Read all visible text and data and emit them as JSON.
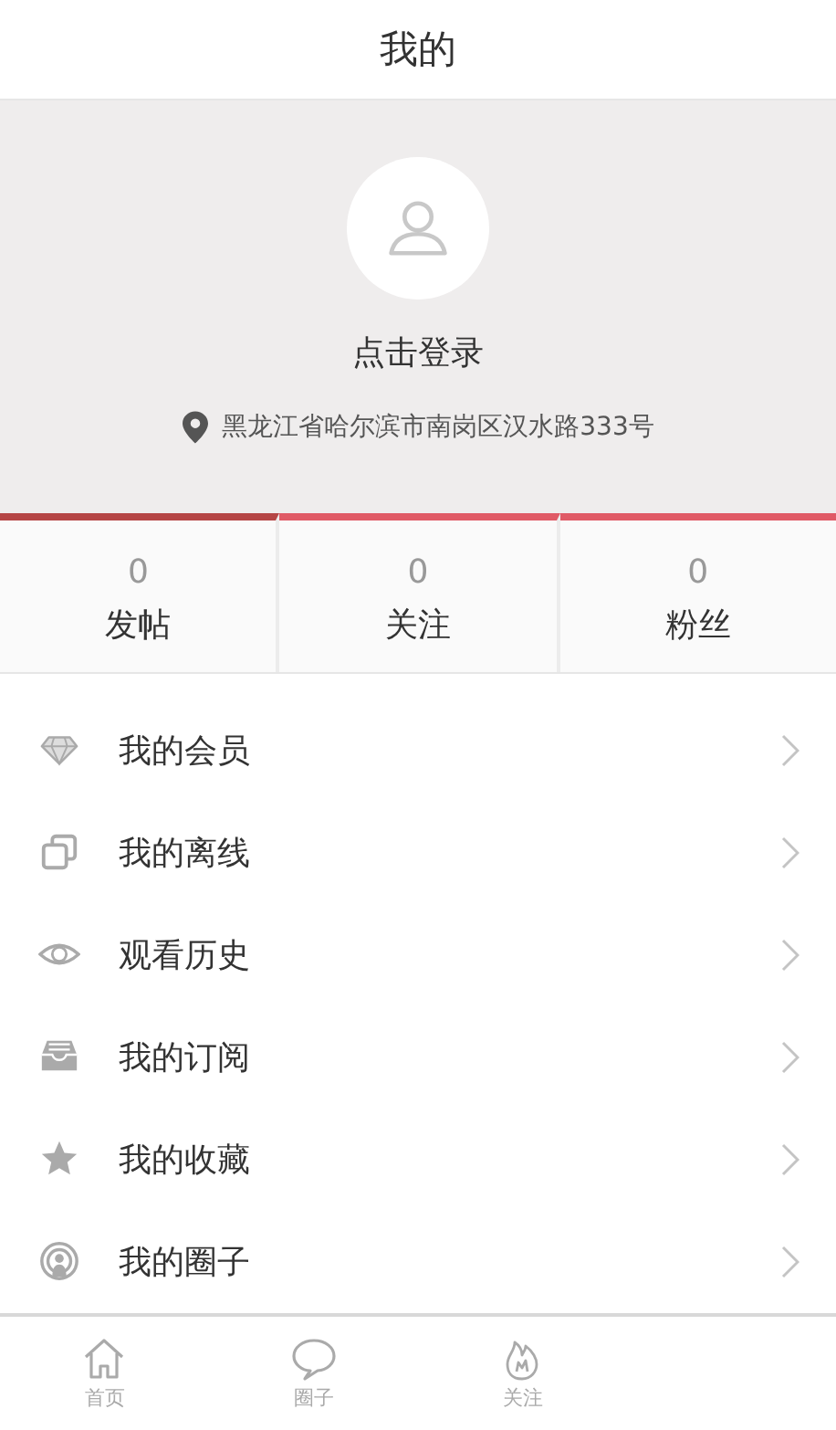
{
  "header": {
    "title": "我的"
  },
  "profile": {
    "login": "点击登录",
    "address": "黑龙江省哈尔滨市南岗区汉水路333号"
  },
  "stats": [
    {
      "count": "0",
      "label": "发帖",
      "selected": true
    },
    {
      "count": "0",
      "label": "关注",
      "selected": false
    },
    {
      "count": "0",
      "label": "粉丝",
      "selected": false
    }
  ],
  "menu": [
    {
      "kind": "diamond",
      "label": "我的会员"
    },
    {
      "kind": "offline",
      "label": "我的离线"
    },
    {
      "kind": "eye",
      "label": "观看历史"
    },
    {
      "kind": "inbox",
      "label": "我的订阅"
    },
    {
      "kind": "star",
      "label": "我的收藏"
    },
    {
      "kind": "circle",
      "label": "我的圈子"
    }
  ],
  "tabbar": [
    {
      "kind": "home",
      "label": "首页"
    },
    {
      "kind": "chat",
      "label": "圈子"
    },
    {
      "kind": "flame",
      "label": "关注"
    }
  ]
}
